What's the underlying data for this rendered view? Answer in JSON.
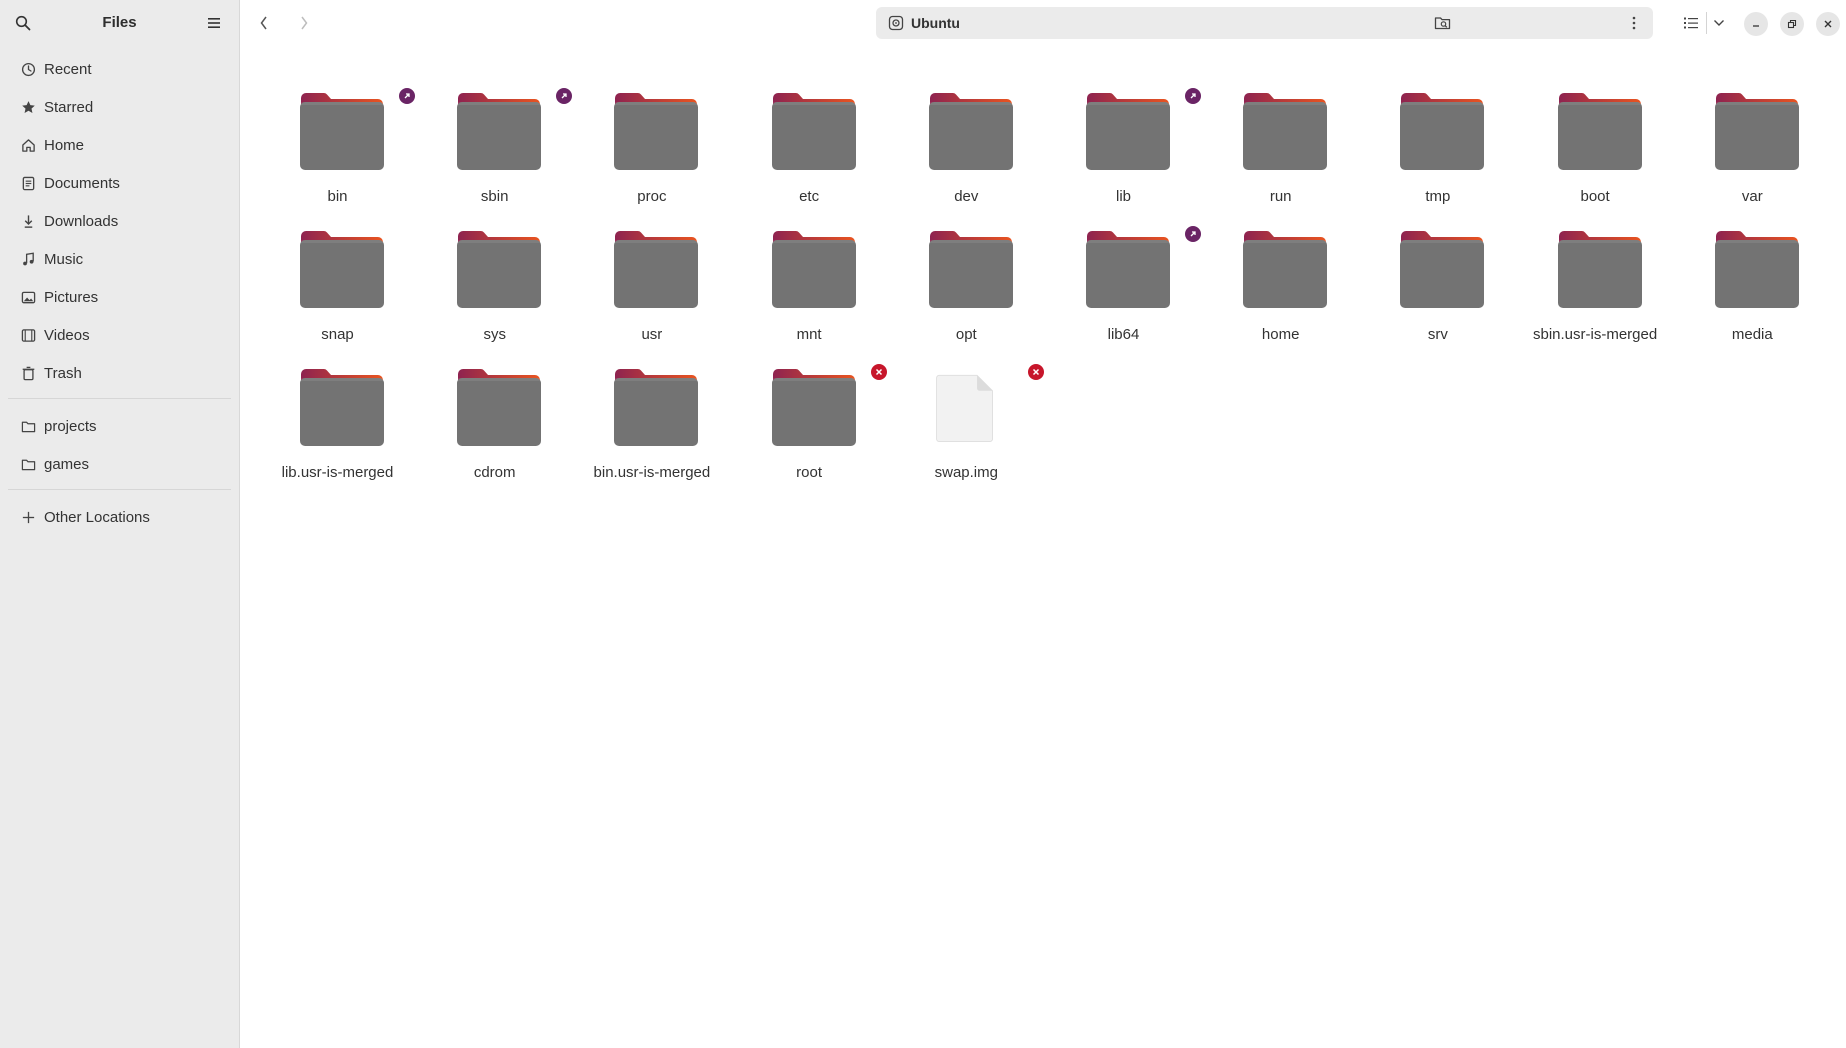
{
  "sidebar": {
    "title": "Files",
    "places": [
      {
        "label": "Recent",
        "icon": "clock-icon"
      },
      {
        "label": "Starred",
        "icon": "star-icon"
      },
      {
        "label": "Home",
        "icon": "home-icon"
      },
      {
        "label": "Documents",
        "icon": "document-icon"
      },
      {
        "label": "Downloads",
        "icon": "download-icon"
      },
      {
        "label": "Music",
        "icon": "music-icon"
      },
      {
        "label": "Pictures",
        "icon": "picture-icon"
      },
      {
        "label": "Videos",
        "icon": "video-icon"
      },
      {
        "label": "Trash",
        "icon": "trash-icon"
      }
    ],
    "bookmarks": [
      {
        "label": "projects",
        "icon": "folder-icon"
      },
      {
        "label": "games",
        "icon": "folder-icon"
      }
    ],
    "other": {
      "label": "Other Locations",
      "icon": "plus-icon"
    }
  },
  "header": {
    "location": "Ubuntu"
  },
  "files": [
    {
      "name": "bin",
      "type": "folder",
      "badge": "link"
    },
    {
      "name": "sbin",
      "type": "folder",
      "badge": "link"
    },
    {
      "name": "proc",
      "type": "folder",
      "badge": ""
    },
    {
      "name": "etc",
      "type": "folder",
      "badge": ""
    },
    {
      "name": "dev",
      "type": "folder",
      "badge": ""
    },
    {
      "name": "lib",
      "type": "folder",
      "badge": "link"
    },
    {
      "name": "run",
      "type": "folder",
      "badge": ""
    },
    {
      "name": "tmp",
      "type": "folder",
      "badge": ""
    },
    {
      "name": "boot",
      "type": "folder",
      "badge": ""
    },
    {
      "name": "var",
      "type": "folder",
      "badge": ""
    },
    {
      "name": "snap",
      "type": "folder",
      "badge": ""
    },
    {
      "name": "sys",
      "type": "folder",
      "badge": ""
    },
    {
      "name": "usr",
      "type": "folder",
      "badge": ""
    },
    {
      "name": "mnt",
      "type": "folder",
      "badge": ""
    },
    {
      "name": "opt",
      "type": "folder",
      "badge": ""
    },
    {
      "name": "lib64",
      "type": "folder",
      "badge": "link"
    },
    {
      "name": "home",
      "type": "folder",
      "badge": ""
    },
    {
      "name": "srv",
      "type": "folder",
      "badge": ""
    },
    {
      "name": "sbin.usr-is-merged",
      "type": "folder",
      "badge": ""
    },
    {
      "name": "media",
      "type": "folder",
      "badge": ""
    },
    {
      "name": "lib.usr-is-merged",
      "type": "folder",
      "badge": ""
    },
    {
      "name": "cdrom",
      "type": "folder",
      "badge": ""
    },
    {
      "name": "bin.usr-is-merged",
      "type": "folder",
      "badge": ""
    },
    {
      "name": "root",
      "type": "folder",
      "badge": "locked"
    },
    {
      "name": "swap.img",
      "type": "file",
      "badge": "locked"
    }
  ],
  "colors": {
    "folder_tab_start": "#8e2350",
    "folder_tab_end": "#e95420",
    "folder_body": "#737373",
    "link_badge": "#6a2465",
    "locked_badge": "#c7162b"
  }
}
